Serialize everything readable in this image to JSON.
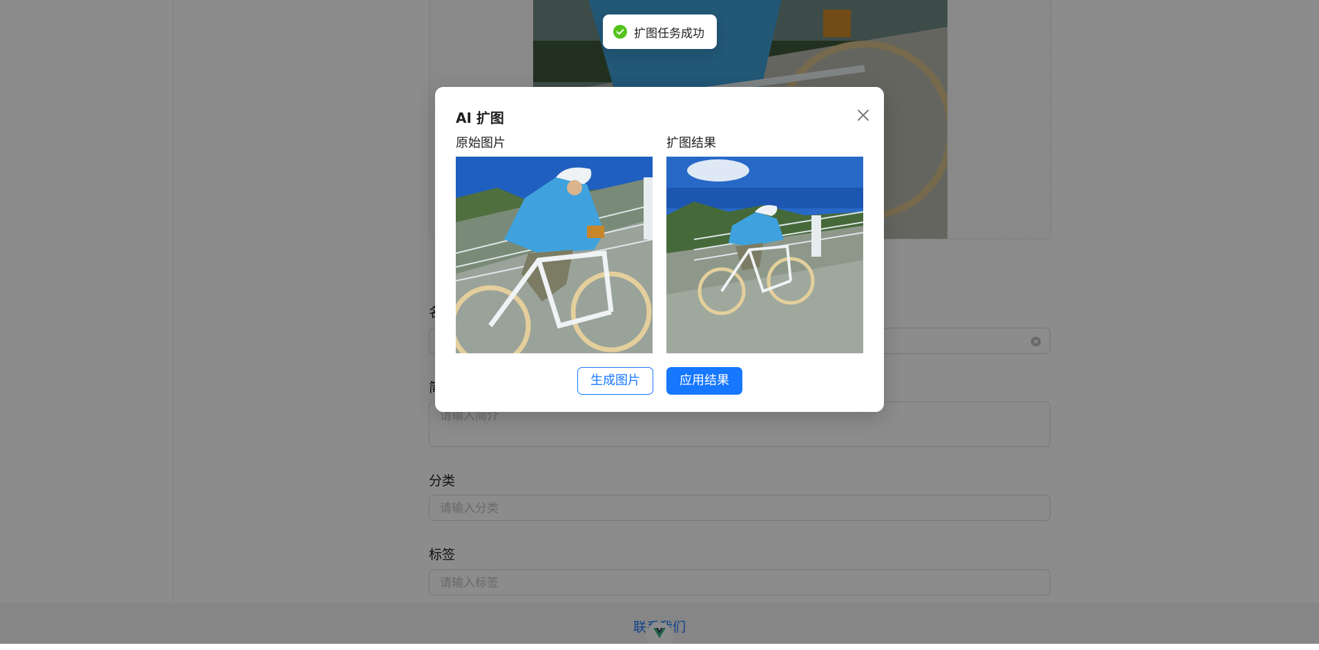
{
  "form": {
    "name_label": "名称",
    "intro_label": "简介",
    "intro_placeholder": "请输入简介",
    "category_label": "分类",
    "category_placeholder": "请输入分类",
    "tags_label": "标签",
    "tags_placeholder": "请输入标签"
  },
  "footer": {
    "contact_link": "联系我们"
  },
  "modal": {
    "title": "AI 扩图",
    "original_label": "原始图片",
    "result_label": "扩图结果",
    "generate_button": "生成图片",
    "apply_button": "应用结果"
  },
  "toast": {
    "message": "扩图任务成功"
  },
  "icons": {
    "close": "close-icon",
    "success": "check-circle-icon",
    "clear": "clear-circle-icon",
    "vue": "vue-logo-icon"
  },
  "colors": {
    "primary": "#1677ff",
    "success": "#52c41a"
  }
}
